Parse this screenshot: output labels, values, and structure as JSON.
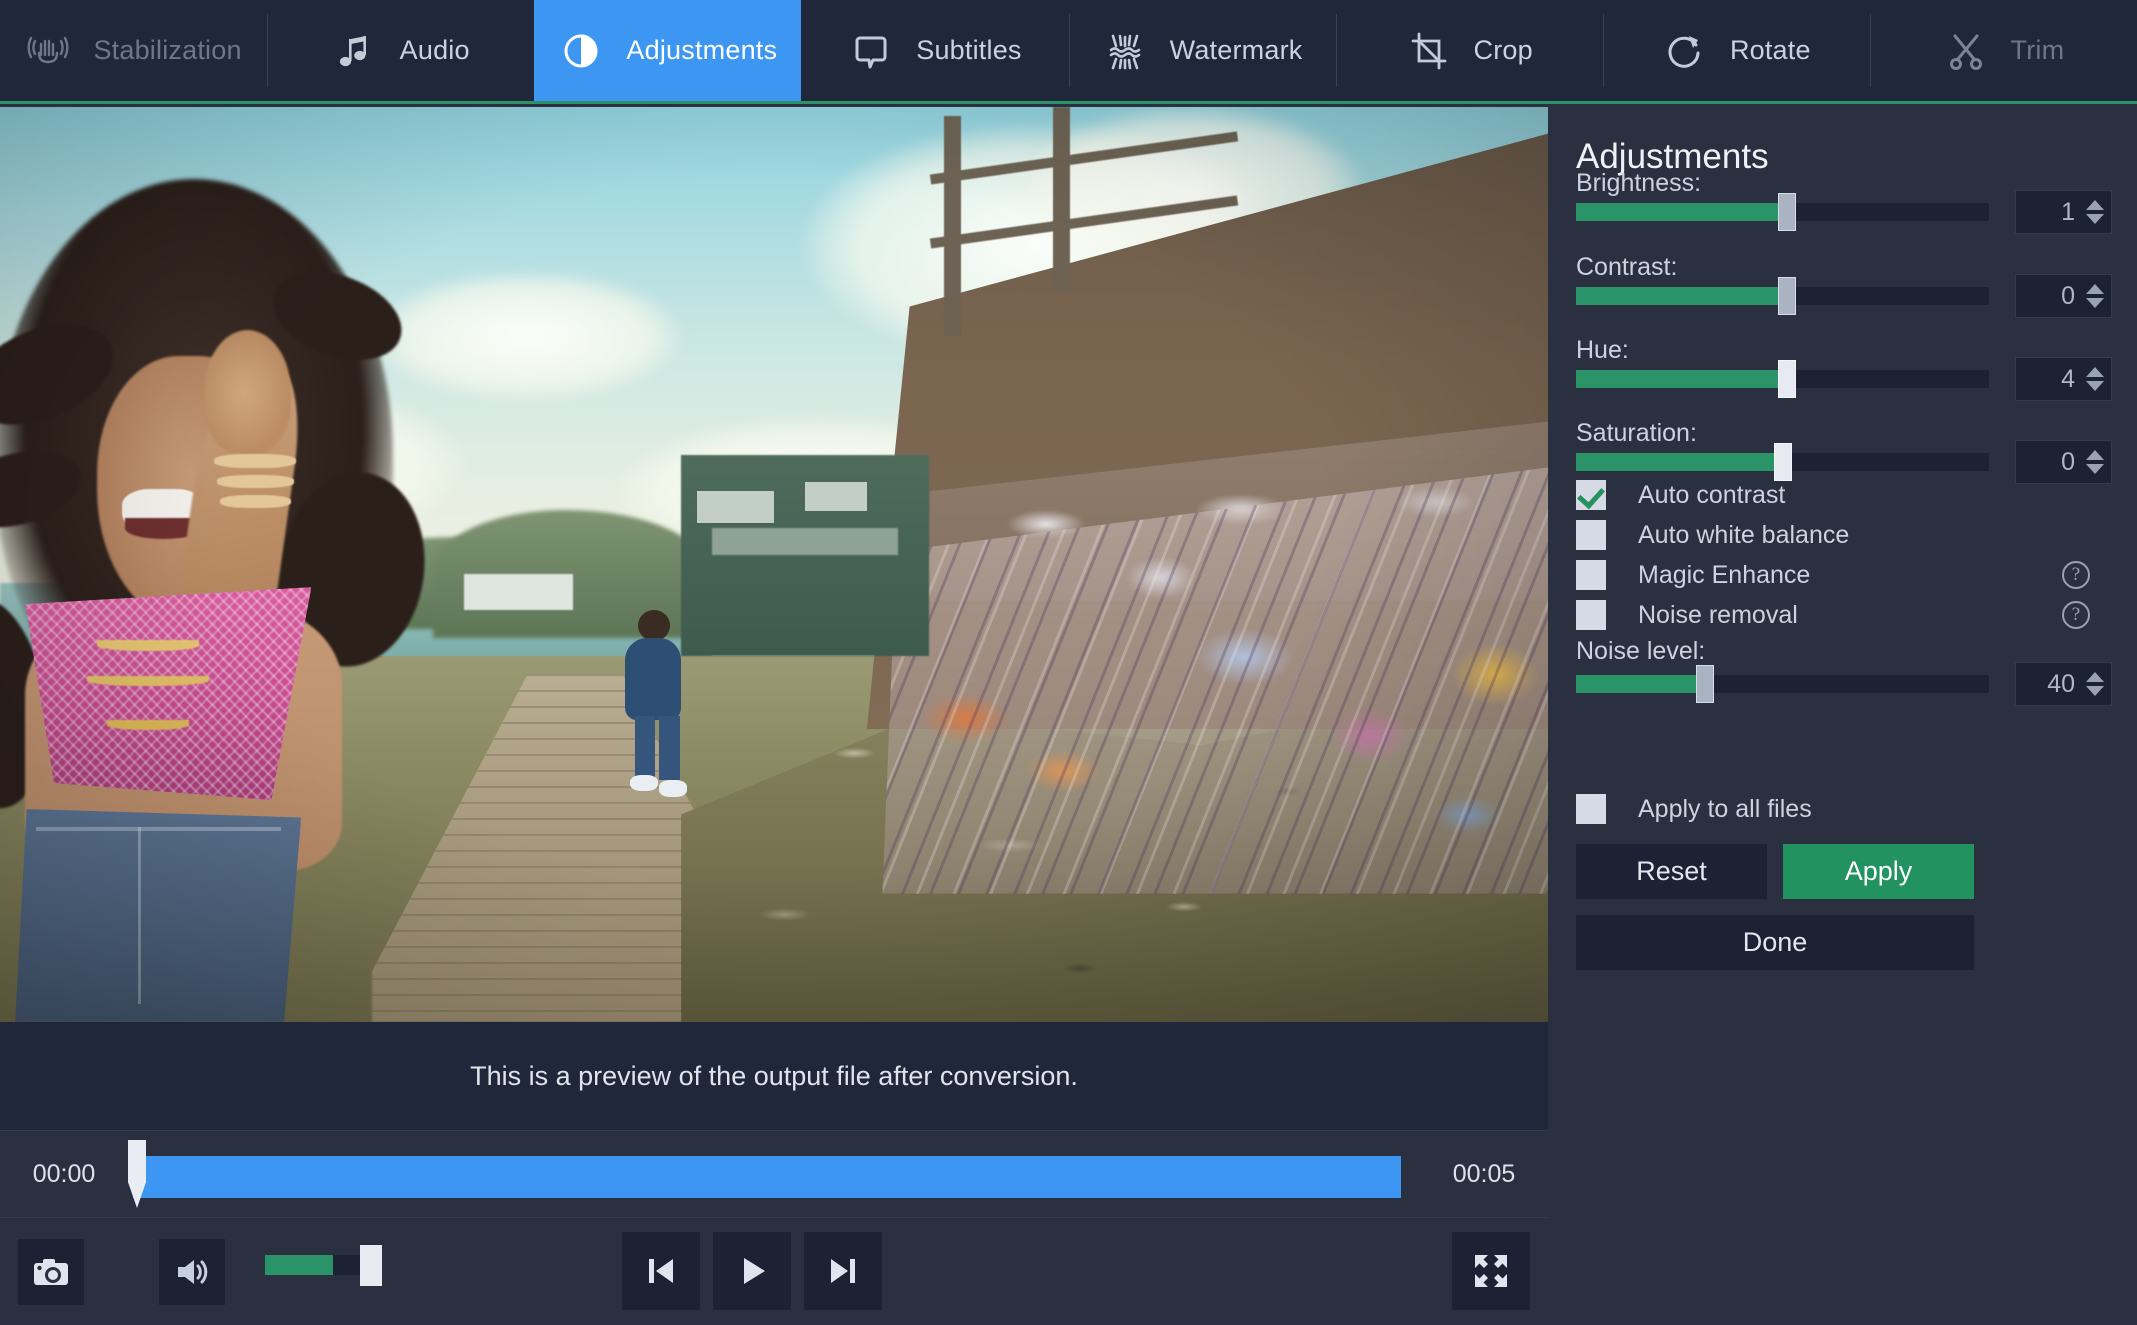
{
  "toolbar": {
    "tabs": [
      {
        "label": "Stabilization",
        "icon": "stabilization-icon",
        "state": "disabled"
      },
      {
        "label": "Audio",
        "icon": "audio-note-icon",
        "state": "normal"
      },
      {
        "label": "Adjustments",
        "icon": "adjustments-contrast-icon",
        "state": "active"
      },
      {
        "label": "Subtitles",
        "icon": "subtitles-bubble-icon",
        "state": "normal"
      },
      {
        "label": "Watermark",
        "icon": "watermark-icon",
        "state": "normal"
      },
      {
        "label": "Crop",
        "icon": "crop-icon",
        "state": "normal"
      },
      {
        "label": "Rotate",
        "icon": "rotate-icon",
        "state": "normal"
      },
      {
        "label": "Trim",
        "icon": "scissors-trim-icon",
        "state": "disabled"
      }
    ],
    "active_accent": "#3d97f2",
    "underline_color": "#2a9468"
  },
  "preview": {
    "caption": "This is a preview of the output file after conversion.",
    "start_time": "00:00",
    "end_time": "00:05",
    "progress_percent": 100,
    "playhead_percent": 0
  },
  "player": {
    "snapshot_label": "camera-icon",
    "volume_label": "speaker-icon",
    "volume_percent": 62,
    "prev_label": "skip-previous-icon",
    "play_label": "play-icon",
    "next_label": "skip-next-icon",
    "fullscreen_label": "fullscreen-icon"
  },
  "panel": {
    "title": "Adjustments",
    "sliders": [
      {
        "label": "Brightness:",
        "value": "1",
        "fill_percent": 49,
        "thumb_style": "gray"
      },
      {
        "label": "Contrast:",
        "value": "0",
        "fill_percent": 49,
        "thumb_style": "gray"
      },
      {
        "label": "Hue:",
        "value": "4",
        "fill_percent": 49,
        "thumb_style": "light"
      },
      {
        "label": "Saturation:",
        "value": "0",
        "fill_percent": 48,
        "thumb_style": "light"
      }
    ],
    "checkboxes": [
      {
        "label": "Auto contrast",
        "checked": true,
        "help": false
      },
      {
        "label": "Auto white balance",
        "checked": false,
        "help": false
      },
      {
        "label": "Magic Enhance",
        "checked": false,
        "help": true
      },
      {
        "label": "Noise removal",
        "checked": false,
        "help": true
      }
    ],
    "noise": {
      "label": "Noise level:",
      "value": "40",
      "fill_percent": 29,
      "thumb_style": "gray"
    },
    "apply_all": {
      "label": "Apply to all files",
      "checked": false
    },
    "buttons": {
      "reset": "Reset",
      "apply": "Apply",
      "done": "Done"
    },
    "help_glyph": "?",
    "accent_green": "#229260",
    "slider_green": "#2a9468"
  }
}
